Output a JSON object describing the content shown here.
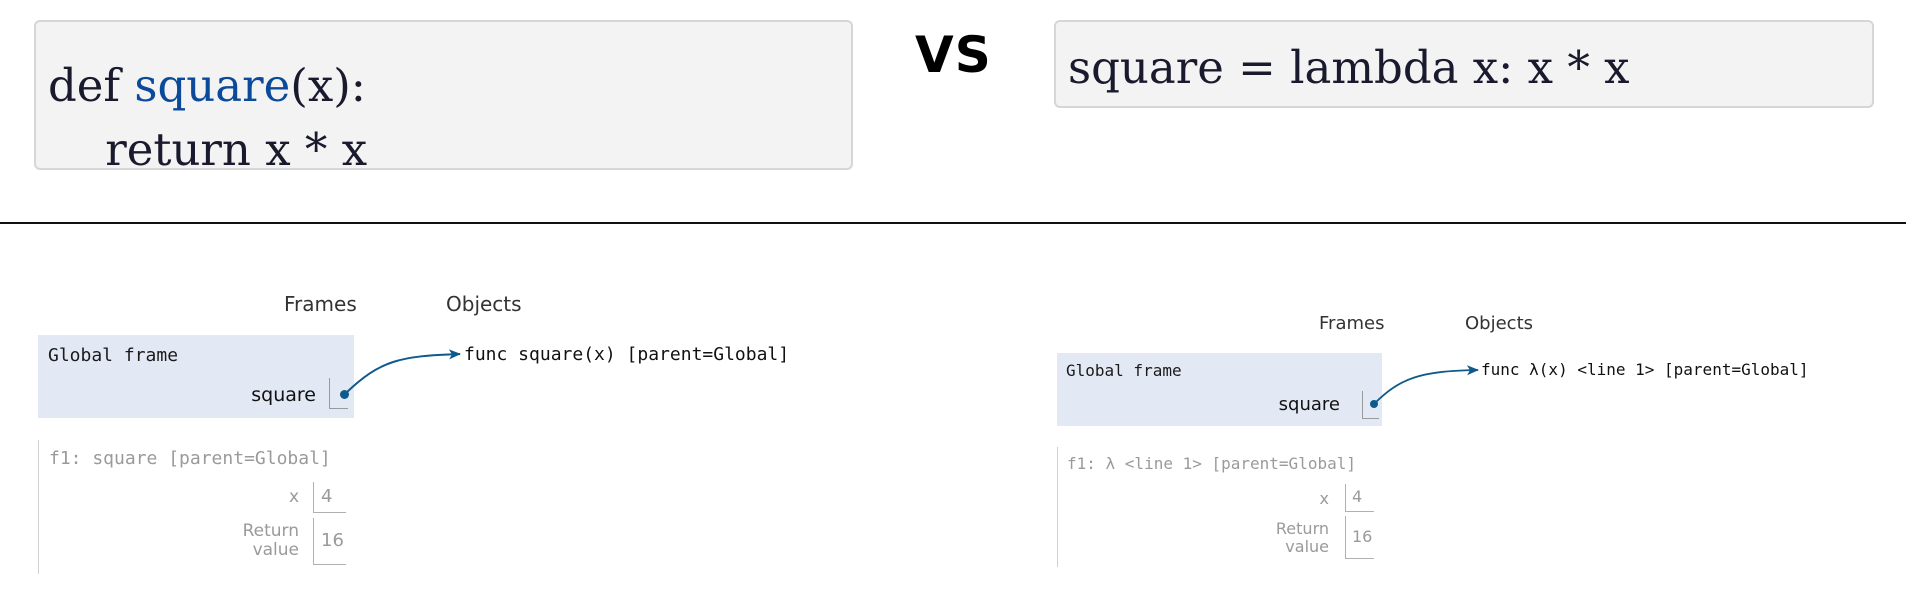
{
  "top": {
    "def_code": {
      "line1_keyword": "def ",
      "line1_name": "square",
      "line1_rest": "(x):",
      "line2": "    return x * x"
    },
    "vs_label": "VS",
    "lambda_code": "square = lambda x: x * x"
  },
  "left_panel": {
    "frames_header": "Frames",
    "objects_header": "Objects",
    "global_frame_title": "Global frame",
    "global_var": "square",
    "object_label": "func square(x) [parent=Global]",
    "f1_title": "f1: square [parent=Global]",
    "f1_x_name": "x",
    "f1_x_value": "4",
    "f1_return_name_line1": "Return",
    "f1_return_name_line2": "value",
    "f1_return_value": "16"
  },
  "right_panel": {
    "frames_header": "Frames",
    "objects_header": "Objects",
    "global_frame_title": "Global frame",
    "global_var": "square",
    "object_label": "func λ(x) <line 1> [parent=Global]",
    "f1_title": "f1: λ <line 1> [parent=Global]",
    "f1_x_name": "x",
    "f1_x_value": "4",
    "f1_return_name_line1": "Return",
    "f1_return_name_line2": "value",
    "f1_return_value": "16"
  },
  "colors": {
    "frame_bg": "#e3e9f4",
    "pointer": "#0e5a8a",
    "function_name": "#0b4a9a"
  }
}
